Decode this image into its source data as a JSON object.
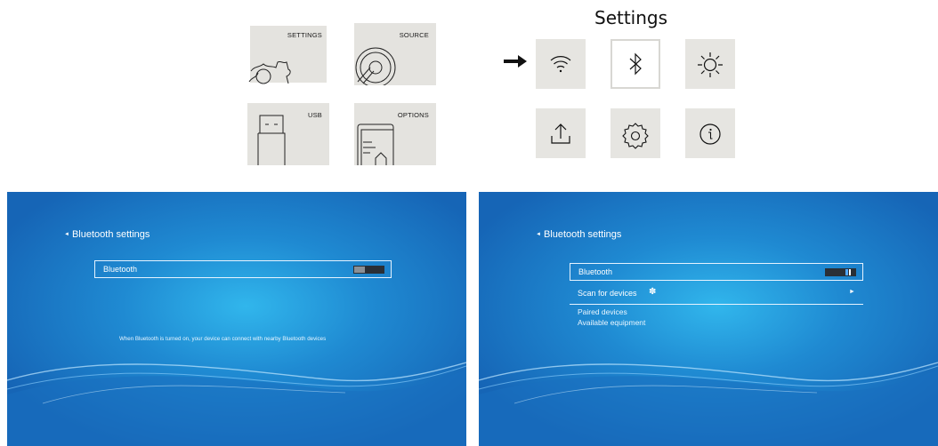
{
  "menu": {
    "tiles": [
      {
        "label": "SETTINGS",
        "icon": "gear-icon"
      },
      {
        "label": "SOURCE",
        "icon": "disc-icon"
      },
      {
        "label": "USB",
        "icon": "usb-drive-icon"
      },
      {
        "label": "OPTIONS",
        "icon": "options-page-icon"
      }
    ]
  },
  "settings": {
    "title": "Settings",
    "icons": [
      "wifi-icon",
      "bluetooth-icon",
      "brightness-icon",
      "upload-icon",
      "gear-icon",
      "info-icon"
    ],
    "selected": "bluetooth-icon"
  },
  "bluetooth_off": {
    "title": "Bluetooth settings",
    "toggle_label": "Bluetooth",
    "toggle_on": false,
    "hint": "When Bluetooth is turned on, your device can connect with nearby Bluetooth devices"
  },
  "bluetooth_on": {
    "title": "Bluetooth settings",
    "toggle_label": "Bluetooth",
    "toggle_on": true,
    "scan_label": "Scan for devices",
    "paired_label": "Paired devices",
    "available_label": "Available equipment"
  },
  "colors": {
    "screen_blue": "#1f8ad2",
    "tile_gray": "#e4e3df",
    "toggle_on": "#4fa6ff"
  }
}
